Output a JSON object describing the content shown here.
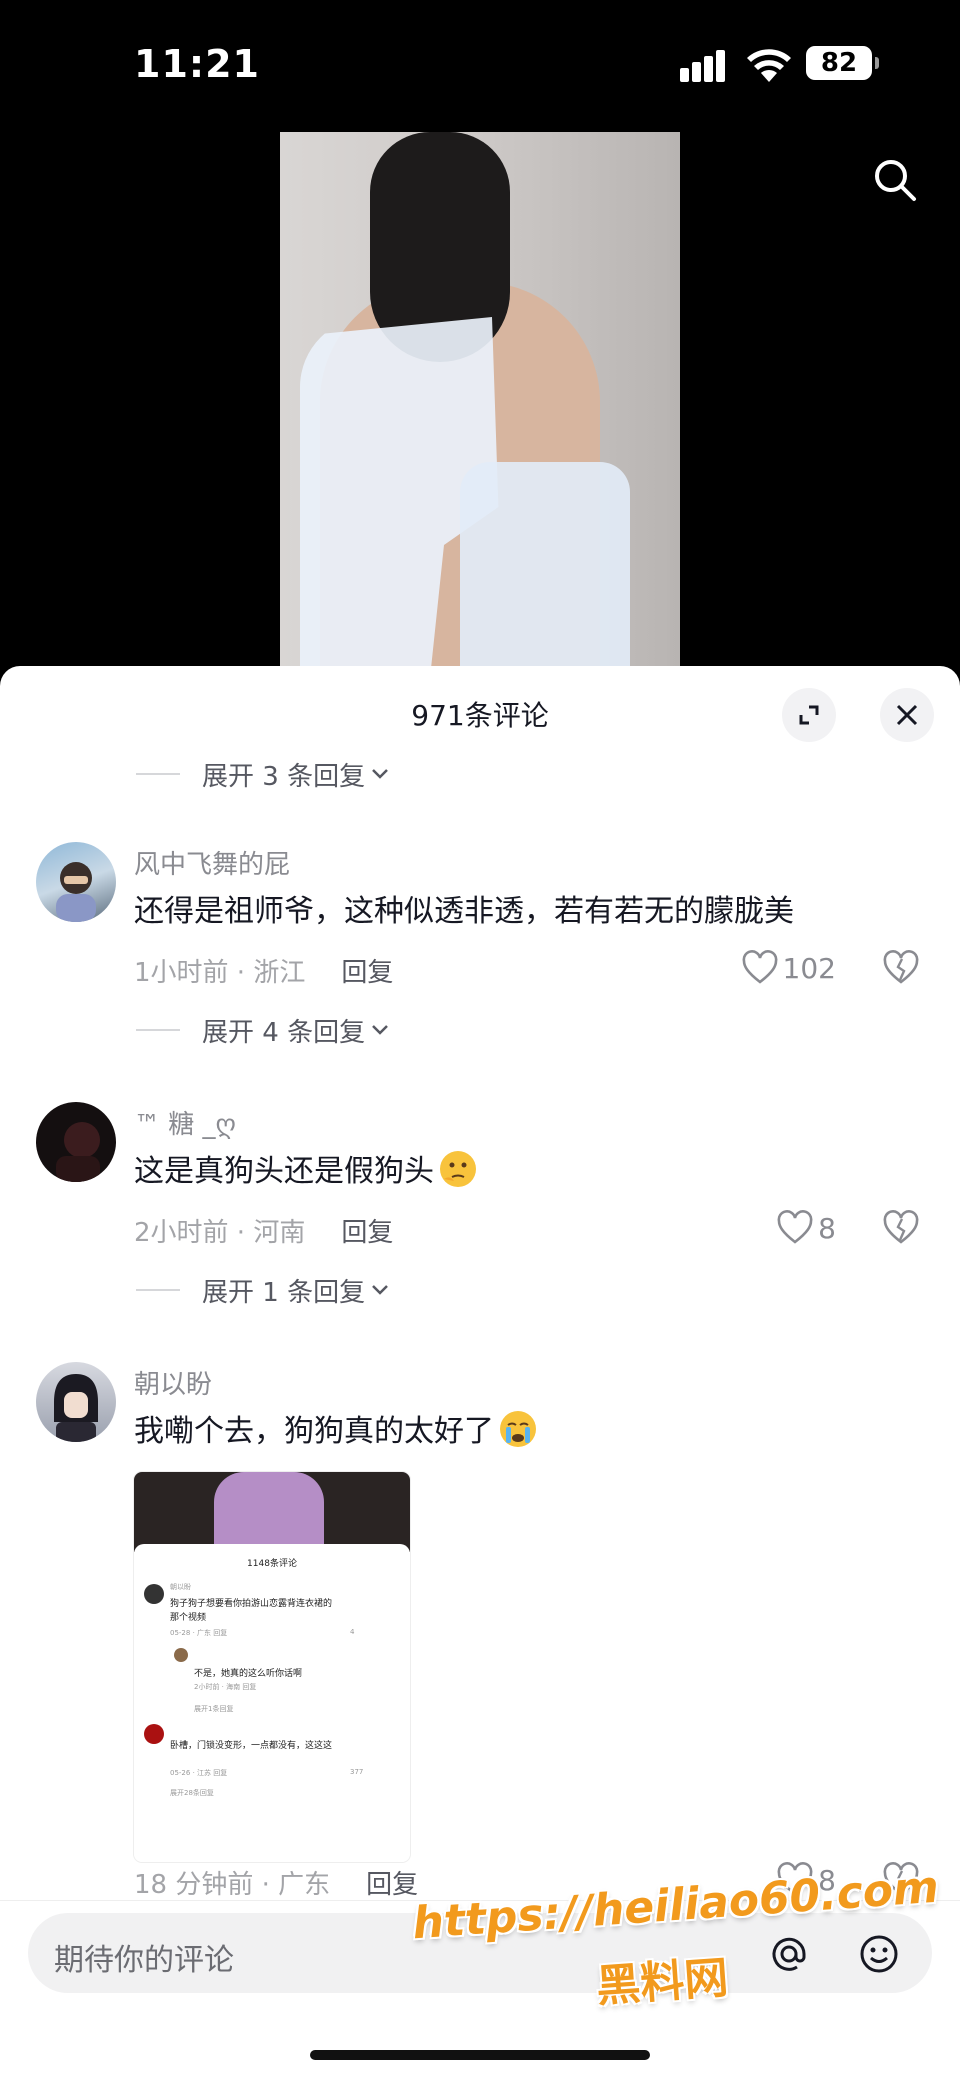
{
  "status_bar": {
    "time": "11:21",
    "battery": "82"
  },
  "comments_panel": {
    "title": "971条评论",
    "expand_top": "展开 3 条回复"
  },
  "comments": [
    {
      "username": "风中飞舞的屁",
      "text": "还得是祖师爷，这种似透非透，若有若无的朦胧美",
      "meta": "1小时前 · 浙江",
      "reply_label": "回复",
      "likes": "102",
      "expand": "展开 4 条回复"
    },
    {
      "username": "™ 糖       _ღ",
      "text": "这是真狗头还是假狗头",
      "emoji": "thinking-face",
      "meta": "2小时前 · 河南",
      "reply_label": "回复",
      "likes": "8",
      "expand": "展开 1 条回复"
    },
    {
      "username": "朝以盼",
      "text": "我嘞个去，狗狗真的太好了",
      "emoji": "crying-face",
      "meta": "18 分钟前 · 广东",
      "reply_label": "回复",
      "likes": "8"
    }
  ],
  "thumbnail": {
    "title": "1148条评论",
    "line1_name": "朝以盼",
    "line1_text": "狗子狗子想要看你拍游山恋露背连衣裙的",
    "line1_text2": "那个视频",
    "line1_meta": "05-28 · 广东   回复",
    "line1_likes": "4",
    "line2_text": "不是，她真的这么听你话啊",
    "line2_meta": "2小时前 · 海南   回复",
    "line2_expand": "展开1条回复",
    "line3_text": "卧槽，门锁没变形，一点都没有，这这这",
    "line3_meta": "05-26 · 江苏   回复",
    "line3_likes": "377",
    "line3_expand": "展开28条回复"
  },
  "input": {
    "placeholder": "期待你的评论"
  },
  "watermark": {
    "line1": "https://heiliao60.com",
    "line2": "黑料网"
  },
  "colors": {
    "accent_watermark": "#f29a1d",
    "text_primary": "#161823",
    "text_secondary": "#8a8b91"
  }
}
